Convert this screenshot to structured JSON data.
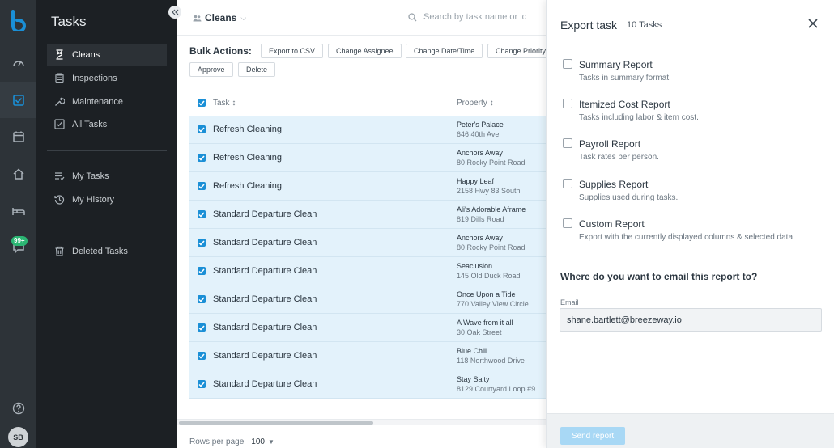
{
  "brand": {
    "accent": "#1a8fd6",
    "row_selected": "#e3f2fb"
  },
  "rail": {
    "icons": [
      "brand-logo-icon",
      "dashboard-gauge-icon",
      "inbox-icon",
      "calendar-icon",
      "home-icon",
      "bed-icon",
      "chat-icon",
      "help-icon"
    ],
    "badge": "99+",
    "avatar": "SB"
  },
  "sidebar": {
    "title": "Tasks",
    "items": [
      {
        "label": "Cleans",
        "icon": "hourglass-icon",
        "active": true
      },
      {
        "label": "Inspections",
        "icon": "clipboard-icon"
      },
      {
        "label": "Maintenance",
        "icon": "wrench-icon"
      },
      {
        "label": "All Tasks",
        "icon": "checkbox-icon"
      }
    ],
    "personal": [
      {
        "label": "My Tasks",
        "icon": "list-icon"
      },
      {
        "label": "My History",
        "icon": "history-icon"
      }
    ],
    "deleted": {
      "label": "Deleted Tasks",
      "icon": "trash-icon"
    }
  },
  "main": {
    "view": "Cleans",
    "search_placeholder": "Search by task name or id",
    "bulk": {
      "label": "Bulk Actions:",
      "buttons": [
        "Export to CSV",
        "Change Assignee",
        "Change Date/Time",
        "Change Priority",
        "Approve",
        "Delete"
      ]
    },
    "columns": {
      "task": "Task",
      "property": "Property"
    },
    "rows": [
      {
        "task": "Refresh Cleaning",
        "property": "Peter's Palace",
        "address": "646 40th Ave"
      },
      {
        "task": "Refresh Cleaning",
        "property": "Anchors Away",
        "address": "80 Rocky Point Road"
      },
      {
        "task": "Refresh Cleaning",
        "property": "Happy Leaf",
        "address": "2158 Hwy 83 South"
      },
      {
        "task": "Standard Departure Clean",
        "property": "Ali's Adorable Aframe",
        "address": "819 Dills Road"
      },
      {
        "task": "Standard Departure Clean",
        "property": "Anchors Away",
        "address": "80 Rocky Point Road"
      },
      {
        "task": "Standard Departure Clean",
        "property": "Seaclusion",
        "address": "145 Old Duck Road"
      },
      {
        "task": "Standard Departure Clean",
        "property": "Once Upon a Tide",
        "address": "770 Valley View Circle"
      },
      {
        "task": "Standard Departure Clean",
        "property": "A Wave from it all",
        "address": "30 Oak Street"
      },
      {
        "task": "Standard Departure Clean",
        "property": "Blue Chill",
        "address": "118 Northwood Drive"
      },
      {
        "task": "Standard Departure Clean",
        "property": "Stay Salty",
        "address": "8129 Courtyard Loop #9"
      }
    ],
    "rows_per_page_label": "Rows per page",
    "rows_per_page": "100"
  },
  "panel": {
    "title": "Export task",
    "count": "10 Tasks",
    "options": [
      {
        "title": "Summary Report",
        "desc": "Tasks in summary format."
      },
      {
        "title": "Itemized Cost Report",
        "desc": "Tasks including labor & item cost."
      },
      {
        "title": "Payroll Report",
        "desc": "Task rates per person."
      },
      {
        "title": "Supplies Report",
        "desc": "Supplies used during tasks."
      },
      {
        "title": "Custom Report",
        "desc": "Export with the currently displayed columns & selected data"
      }
    ],
    "email_question": "Where do you want to email this report to?",
    "email_label": "Email",
    "email_value": "shane.bartlett@breezeway.io",
    "send_label": "Send report"
  }
}
